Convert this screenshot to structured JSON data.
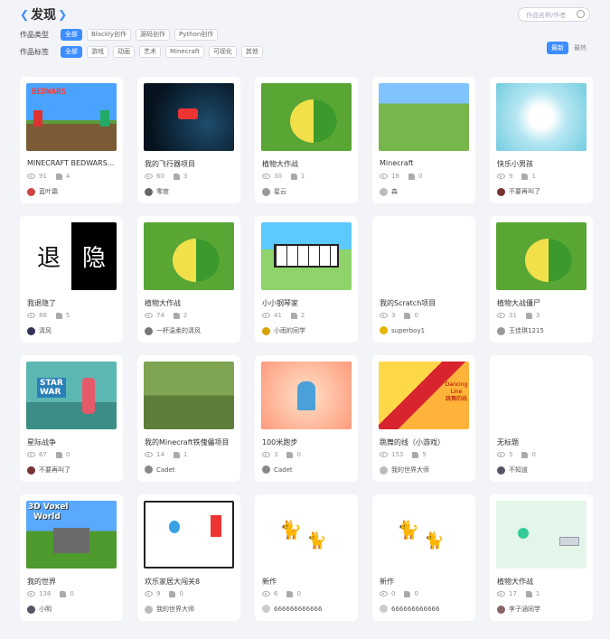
{
  "header": {
    "title": "发现",
    "search_placeholder": "作品名称/作者",
    "filter1_label": "作品类型",
    "filter1_chips": [
      "全部",
      "Blockly创作",
      "源码创作",
      "Python创作"
    ],
    "filter2_label": "作品标签",
    "filter2_chips": [
      "全部",
      "游戏",
      "动画",
      "艺术",
      "Minecraft",
      "可视化",
      "其他"
    ],
    "sort": [
      "最新",
      "最热"
    ]
  },
  "cards": [
    {
      "name": "MINECRAFT BEDWARS...",
      "views": "91",
      "likes": "4",
      "author": "蓝叶霜"
    },
    {
      "name": "我的飞行器项目",
      "views": "60",
      "likes": "3",
      "author": "零度"
    },
    {
      "name": "植物大作战",
      "views": "30",
      "likes": "1",
      "author": "星云"
    },
    {
      "name": "Minecraft",
      "views": "18",
      "likes": "0",
      "author": "森"
    },
    {
      "name": "快乐小男孩",
      "views": "9",
      "likes": "1",
      "author": "不要再叫了"
    },
    {
      "name": "我退隐了",
      "views": "88",
      "likes": "5",
      "author": "清风"
    },
    {
      "name": "植物大作战",
      "views": "74",
      "likes": "2",
      "author": "一杯温柔的清风"
    },
    {
      "name": "小小钢琴家",
      "views": "41",
      "likes": "2",
      "author": "小雨的同学"
    },
    {
      "name": "我的Scratch项目",
      "views": "3",
      "likes": "0",
      "author": "superboy1"
    },
    {
      "name": "植物大战僵尸",
      "views": "31",
      "likes": "3",
      "author": "王佳琪1215"
    },
    {
      "name": "星际战争",
      "views": "67",
      "likes": "0",
      "author": "不要再叫了"
    },
    {
      "name": "我的Minecraft铁傀儡项目",
      "views": "14",
      "likes": "1",
      "author": "Cadet"
    },
    {
      "name": "100米跑步",
      "views": "3",
      "likes": "0",
      "author": "Cadet"
    },
    {
      "name": "跳舞的线（小游戏）",
      "views": "153",
      "likes": "5",
      "author": "我的世界大师"
    },
    {
      "name": "无标题",
      "views": "5",
      "likes": "0",
      "author": "不知道"
    },
    {
      "name": "我的世界",
      "views": "138",
      "likes": "0",
      "author": "小明"
    },
    {
      "name": "欢乐家居大闯关8",
      "views": "9",
      "likes": "0",
      "author": "我的世界大师"
    },
    {
      "name": "新作",
      "views": "6",
      "likes": "0",
      "author": "666666666666"
    },
    {
      "name": "新作",
      "views": "0",
      "likes": "0",
      "author": "666666666666"
    },
    {
      "name": "植物大作战",
      "views": "17",
      "likes": "1",
      "author": "李子涵同学"
    }
  ],
  "thumb_text": {
    "bedwars": "BEDWARS",
    "tui": "退",
    "yin": "隐",
    "star": "STAR",
    "war": "WAR",
    "voxel": "3D Voxel",
    "world": "World",
    "dance": "Dancing Line",
    "dance_cn": "跳舞的线"
  }
}
